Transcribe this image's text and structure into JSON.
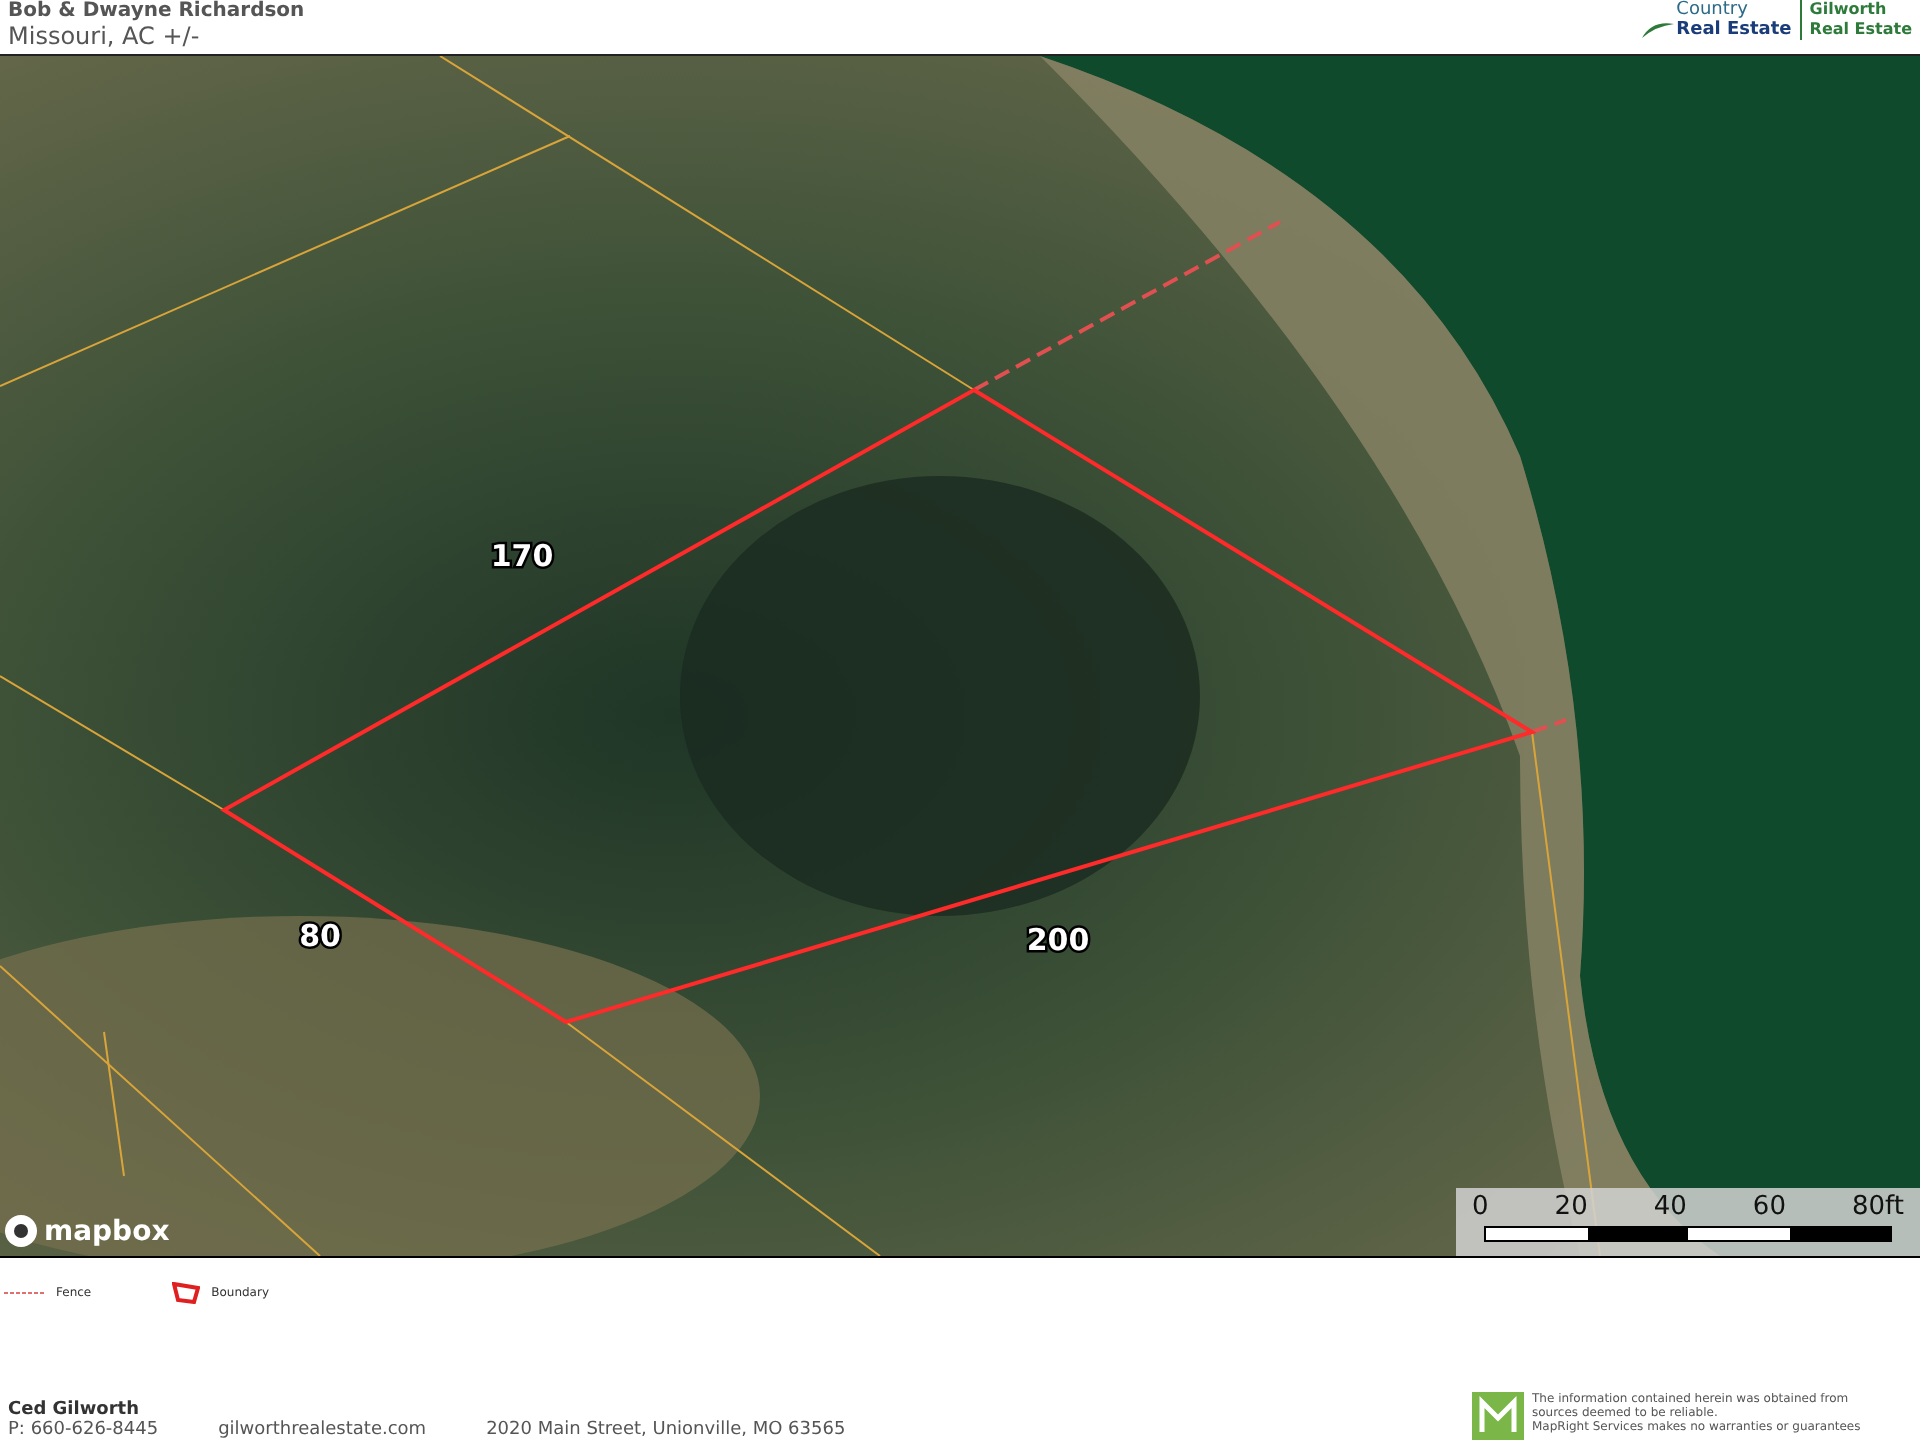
{
  "header": {
    "title": "Bob & Dwayne Richardson",
    "subtitle": "Missouri,  AC +/-"
  },
  "logos": [
    {
      "kind": "country",
      "lines": [
        "Country",
        "Real Estate"
      ]
    },
    {
      "kind": "gilworth",
      "lines": [
        "Gilworth",
        "Real Estate"
      ]
    }
  ],
  "map": {
    "attribution": "mapbox",
    "labels": [
      "170",
      "80",
      "200"
    ],
    "scale": [
      "0",
      "20",
      "40",
      "60",
      "80ft"
    ]
  },
  "legend": [
    {
      "kind": "fence",
      "label": "Fence"
    },
    {
      "kind": "boundary",
      "label": "Boundary"
    }
  ],
  "footer": {
    "name": "Ced Gilworth",
    "phone": "P: 660-626-8445",
    "website": "gilworthrealestate.com",
    "address": "2020 Main Street, Unionville, MO 63565",
    "disclaimer": [
      "The information contained herein was obtained from",
      "sources deemed to be reliable.",
      "MapRight Services makes no warranties or guarantees"
    ]
  }
}
